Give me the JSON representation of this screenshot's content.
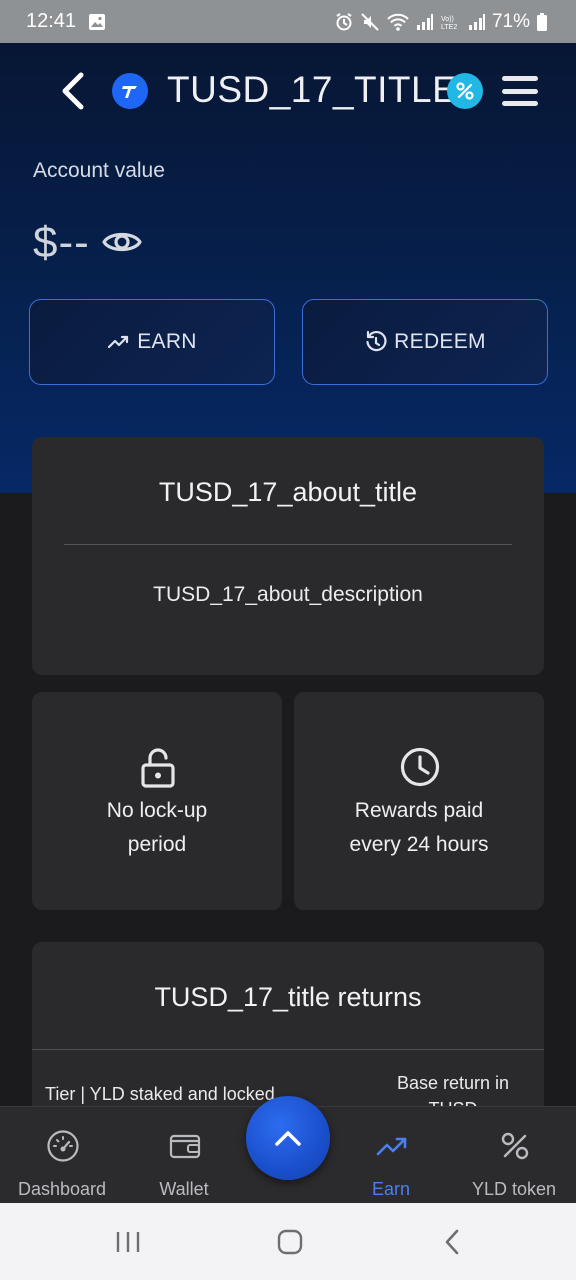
{
  "status_bar": {
    "time": "12:41",
    "battery": "71%"
  },
  "header": {
    "title": "TUSD_17_TITLE",
    "back_icon": "chevron-left-icon",
    "menu_icon": "hamburger-menu-icon"
  },
  "account": {
    "label": "Account value",
    "value": "$--"
  },
  "actions": {
    "earn_label": "EARN",
    "redeem_label": "REDEEM"
  },
  "about": {
    "title": "TUSD_17_about_title",
    "description": "TUSD_17_about_description"
  },
  "features": [
    {
      "icon": "lock-open-icon",
      "line1": "No lock-up",
      "line2": "period"
    },
    {
      "icon": "clock-icon",
      "line1": "Rewards paid",
      "line2": "every 24 hours"
    }
  ],
  "returns": {
    "title": "TUSD_17_title returns",
    "col_tier": "Tier | YLD staked and locked",
    "col_base_line1": "Base return in",
    "col_base_line2": "TUSD"
  },
  "bottom_nav": {
    "items": [
      {
        "label": "Dashboard",
        "icon": "speedometer-icon",
        "active": false
      },
      {
        "label": "Wallet",
        "icon": "wallet-icon",
        "active": false
      },
      {
        "label": "Earn",
        "icon": "trending-up-icon",
        "active": true
      },
      {
        "label": "YLD token",
        "icon": "percent-icon",
        "active": false
      }
    ]
  },
  "colors": {
    "accent": "#4b7ff0",
    "hero_top": "#071634",
    "hero_bottom": "#062866",
    "card_bg": "#2a2a2c",
    "page_bg": "#1b1b1d"
  }
}
